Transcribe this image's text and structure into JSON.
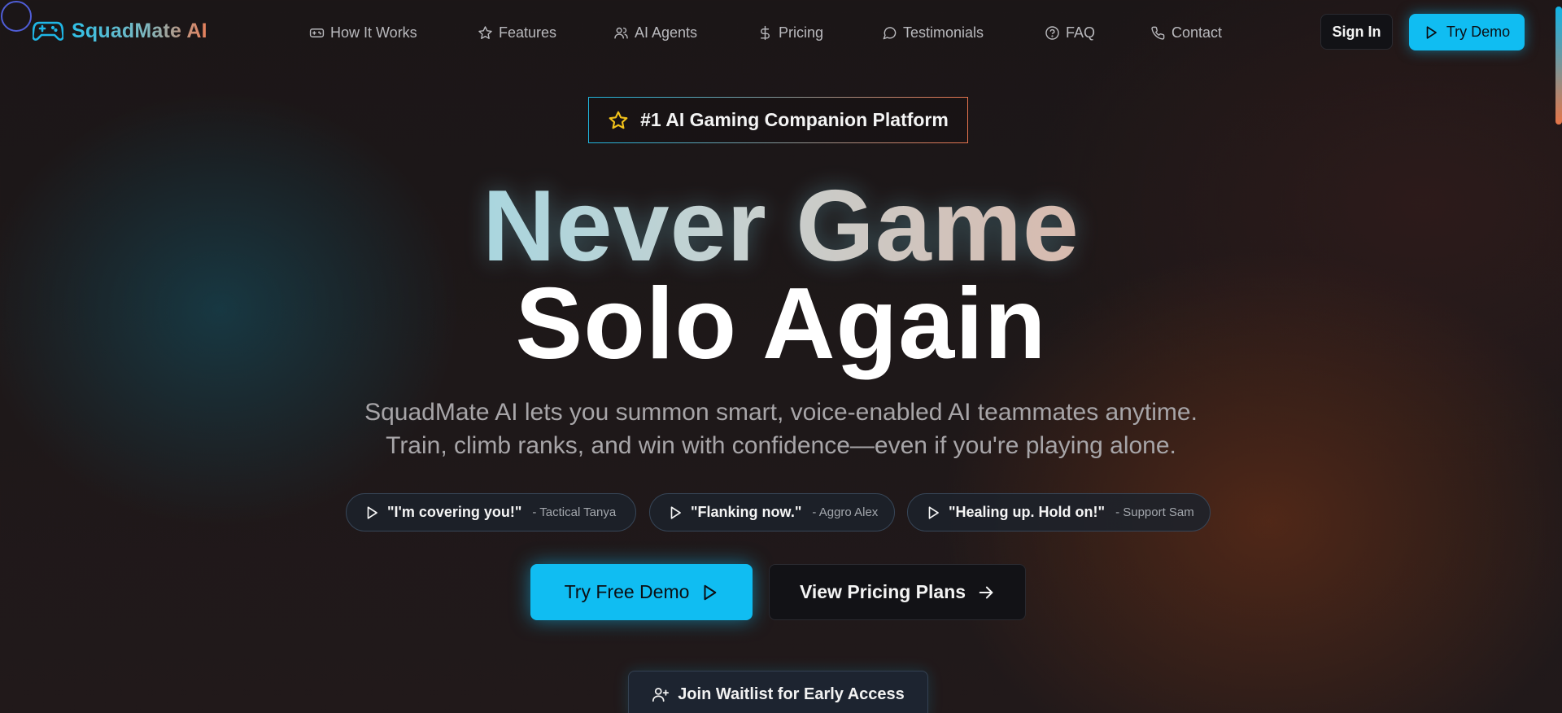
{
  "brand": {
    "name": "SquadMate AI"
  },
  "nav": {
    "links": [
      {
        "label": "How It Works",
        "icon": "gamepad-icon"
      },
      {
        "label": "Features",
        "icon": "star-icon"
      },
      {
        "label": "AI Agents",
        "icon": "users-icon"
      },
      {
        "label": "Pricing",
        "icon": "dollar-icon"
      },
      {
        "label": "Testimonials",
        "icon": "message-circle-icon"
      },
      {
        "label": "FAQ",
        "icon": "help-circle-icon"
      },
      {
        "label": "Contact",
        "icon": "phone-icon"
      }
    ],
    "signin_label": "Sign In",
    "trydemo_label": "Try Demo"
  },
  "hero": {
    "badge": "#1 AI Gaming Companion Platform",
    "headline_line1": "Never Game",
    "headline_line2": "Solo Again",
    "subtitle_line1": "SquadMate AI lets you summon smart, voice-enabled AI teammates anytime.",
    "subtitle_line2": "Train, climb ranks, and win with confidence—even if you're playing alone.",
    "quotes": [
      {
        "text": "\"I'm covering you!\"",
        "author": "- Tactical Tanya"
      },
      {
        "text": "\"Flanking now.\"",
        "author": "- Aggro Alex"
      },
      {
        "text": "\"Healing up. Hold on!\"",
        "author": "- Support Sam"
      }
    ],
    "cta_primary": "Try Free Demo",
    "cta_secondary": "View Pricing Plans",
    "waitlist": "Join Waitlist for Early Access"
  },
  "colors": {
    "accent": "#10bdf2",
    "accent_warm": "#e8805a",
    "background": "#1b1617"
  }
}
